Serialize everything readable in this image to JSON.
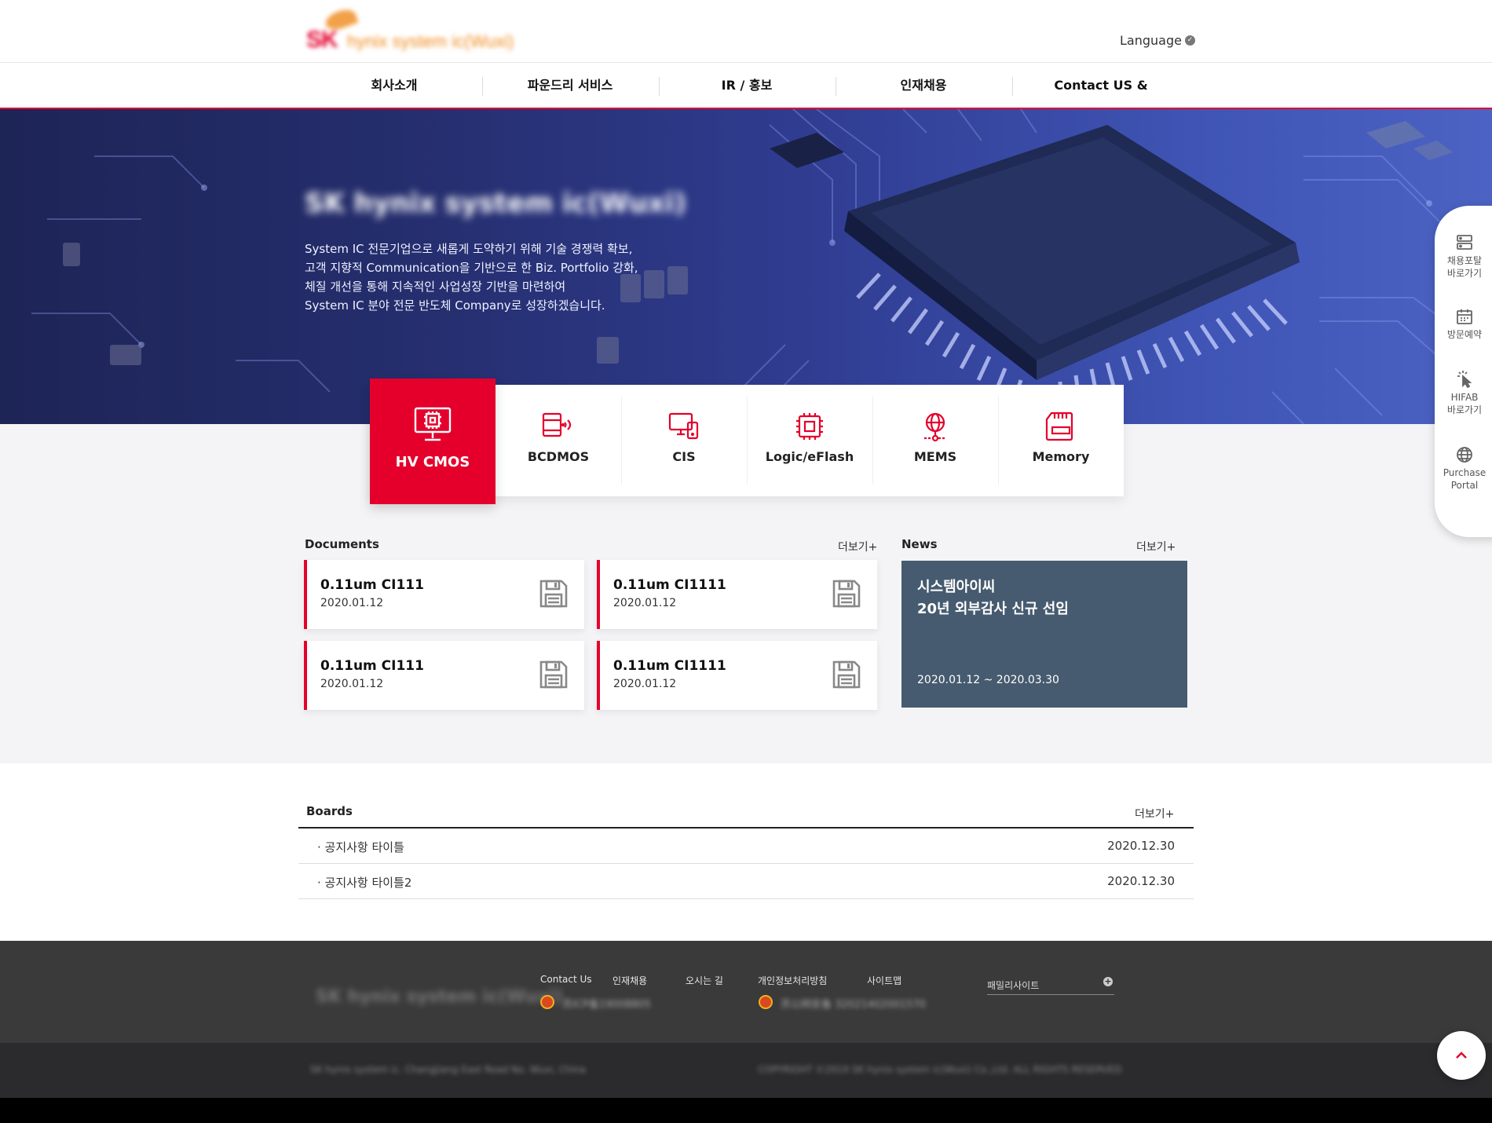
{
  "header": {
    "logo_sk": "SK",
    "logo_text": "hynix system ic(Wuxi)",
    "language_label": "Language"
  },
  "nav": {
    "items": [
      {
        "label": "회사소개"
      },
      {
        "label": "파운드리 서비스"
      },
      {
        "label": "IR / 홍보"
      },
      {
        "label": "인재채용"
      },
      {
        "label": "Contact US & Support"
      }
    ]
  },
  "hero": {
    "title": "SK hynix system ic(Wuxi)",
    "description": [
      "System IC 전문기업으로 새롭게 도약하기 위해 기술 경쟁력 확보,",
      "고객 지향적 Communication을 기반으로 한 Biz. Portfolio 강화,",
      "체질 개선을 통해 지속적인 사업성장 기반을 마련하여",
      "System IC 분야 전문 반도체 Company로 성장하겠습니다."
    ]
  },
  "products": {
    "active_index": 0,
    "tabs": [
      {
        "label": "HV CMOS",
        "icon": "monitor-chip-icon"
      },
      {
        "label": "BCDMOS",
        "icon": "device-signal-icon"
      },
      {
        "label": "CIS",
        "icon": "devices-icon"
      },
      {
        "label": "Logic/eFlash",
        "icon": "chip-icon"
      },
      {
        "label": "MEMS",
        "icon": "globe-node-icon"
      },
      {
        "label": "Memory",
        "icon": "memory-card-icon"
      }
    ],
    "accent_color": "#e4002b"
  },
  "documents": {
    "title": "Documents",
    "more": "더보기+",
    "items": [
      {
        "title": "0.11um CI111",
        "date": "2020.01.12"
      },
      {
        "title": "0.11um CI1111",
        "date": "2020.01.12"
      },
      {
        "title": "0.11um CI111",
        "date": "2020.01.12"
      },
      {
        "title": "0.11um CI1111",
        "date": "2020.01.12"
      }
    ],
    "icon": "save-icon"
  },
  "news": {
    "title": "News",
    "more": "더보기+",
    "headline_line1": "시스템아이씨",
    "headline_line2": "20년 외부감사 신규 선임",
    "period": "2020.01.12 ~ 2020.03.30",
    "background": "#465b6f"
  },
  "boards": {
    "title": "Boards",
    "more": "더보기+",
    "rows": [
      {
        "title": "· 공지사항 타이틀",
        "date": "2020.12.30"
      },
      {
        "title": "· 공지사항 타이틀2",
        "date": "2020.12.30"
      }
    ]
  },
  "footer": {
    "logo_text": "SK hynix system ic(Wuxi)",
    "links": [
      "Contact Us",
      "인재채용",
      "오시는 길",
      "개인정보처리방침",
      "사이트맵"
    ],
    "license1": "苏ICP备19008805",
    "license2": "苏公网安备 32021402001570",
    "family_site": "패밀리사이트",
    "address": "SK hynix system ic. Changjiang East Road No. Wuxi, China",
    "copyright": "COPYRIGHT ©2019 SK hynix system ic(Wuxi) Co.,Ltd. ALL RIGHTS RESERVED"
  },
  "quick_menu": {
    "items": [
      {
        "label_line1": "채용포탈",
        "label_line2": "바로가기",
        "icon": "server-icon"
      },
      {
        "label_line1": "방문예약",
        "label_line2": "",
        "icon": "calendar-icon"
      },
      {
        "label_line1": "HIFAB",
        "label_line2": "바로가기",
        "icon": "click-cursor-icon"
      },
      {
        "label_line1": "Purchase",
        "label_line2": "Portal",
        "icon": "globe-icon"
      }
    ]
  },
  "scroll_top_icon": "chevron-up-icon"
}
